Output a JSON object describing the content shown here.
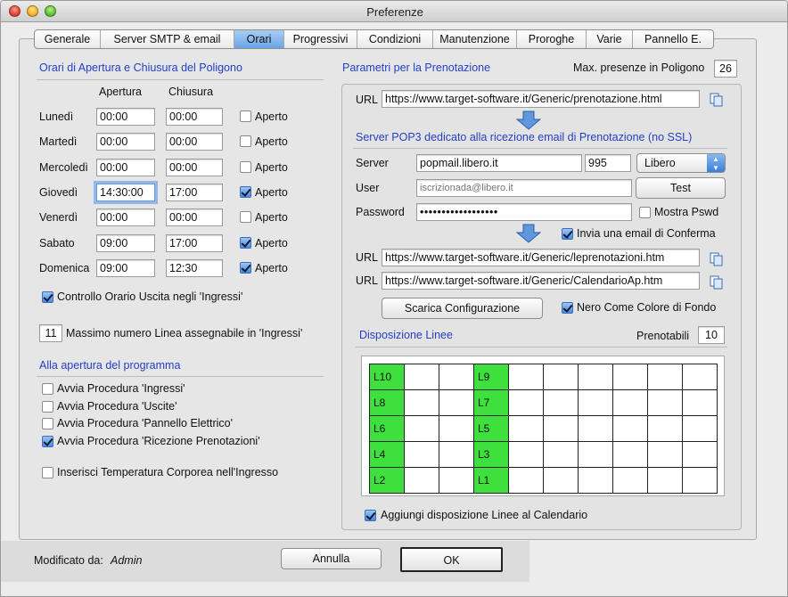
{
  "window": {
    "title": "Preferenze"
  },
  "tabs": [
    {
      "label": "Generale",
      "w": 74
    },
    {
      "label": "Server SMTP & email",
      "w": 150
    },
    {
      "label": "Orari",
      "w": 56,
      "active": true
    },
    {
      "label": "Progressivi",
      "w": 82
    },
    {
      "label": "Condizioni",
      "w": 85
    },
    {
      "label": "Manutenzione",
      "w": 94
    },
    {
      "label": "Proroghe",
      "w": 78
    },
    {
      "label": "Varie",
      "w": 52
    },
    {
      "label": "Pannello E.",
      "w": 90
    }
  ],
  "orari": {
    "title": "Orari di Apertura e Chiusura del Poligono",
    "col_apertura": "Apertura",
    "col_chiusura": "Chiusura",
    "aperto_label": "Aperto",
    "days": [
      {
        "name": "Lunedì",
        "open": "00:00",
        "close": "00:00",
        "aperto": false
      },
      {
        "name": "Martedì",
        "open": "00:00",
        "close": "00:00",
        "aperto": false
      },
      {
        "name": "Mercoledì",
        "open": "00:00",
        "close": "00:00",
        "aperto": false
      },
      {
        "name": "Giovedì",
        "open": "14:30:00",
        "close": "17:00",
        "aperto": true
      },
      {
        "name": "Venerdì",
        "open": "00:00",
        "close": "00:00",
        "aperto": false
      },
      {
        "name": "Sabato",
        "open": "09:00",
        "close": "17:00",
        "aperto": true
      },
      {
        "name": "Domenica",
        "open": "09:00",
        "close": "12:30",
        "aperto": true
      }
    ],
    "controllo_label": "Controllo Orario Uscita negli 'Ingressi'",
    "controllo_checked": true,
    "max_linea_value": "11",
    "max_linea_label": "Massimo numero Linea assegnabile in 'Ingressi'"
  },
  "apertura": {
    "title": "Alla apertura del programma",
    "items": [
      {
        "label": "Avvia Procedura 'Ingressi'",
        "checked": false
      },
      {
        "label": "Avvia Procedura 'Uscite'",
        "checked": false
      },
      {
        "label": "Avvia Procedura 'Pannello Elettrico'",
        "checked": false
      },
      {
        "label": "Avvia Procedura 'Ricezione Prenotazioni'",
        "checked": true
      }
    ],
    "temperatura_label": "Inserisci Temperatura Corporea nell'Ingresso",
    "temperatura_checked": false
  },
  "prenotazione": {
    "title": "Parametri per la Prenotazione",
    "max_presenze_label": "Max. presenze in Poligono",
    "max_presenze_value": "26",
    "url_label": "URL",
    "url1": "https://www.target-software.it/Generic/prenotazione.html",
    "pop3_title": "Server POP3 dedicato alla ricezione email di Prenotazione (no SSL)",
    "server_label": "Server",
    "server_value": "popmail.libero.it",
    "port_value": "995",
    "provider": "Libero",
    "user_label": "User",
    "user_value": "iscrizionada@libero.it",
    "test_label": "Test",
    "password_label": "Password",
    "password_value": "••••••••••••••••••",
    "mostra_label": "Mostra Pswd",
    "mostra_checked": false,
    "invia_label": "Invia una email di Conferma",
    "invia_checked": true,
    "url2": "https://www.target-software.it/Generic/leprenotazioni.htm",
    "url3": "https://www.target-software.it/Generic/CalendarioAp.htm",
    "scarica_label": "Scarica Configurazione",
    "nero_label": "Nero Come Colore di Fondo",
    "nero_checked": true
  },
  "linee": {
    "title": "Disposizione Linee",
    "prenotabili_label": "Prenotabili",
    "prenotabili_value": "10",
    "rows": [
      [
        "L10",
        "",
        "",
        "L9",
        "",
        "",
        "",
        "",
        "",
        ""
      ],
      [
        "L8",
        "",
        "",
        "L7",
        "",
        "",
        "",
        "",
        "",
        ""
      ],
      [
        "L6",
        "",
        "",
        "L5",
        "",
        "",
        "",
        "",
        "",
        ""
      ],
      [
        "L4",
        "",
        "",
        "L3",
        "",
        "",
        "",
        "",
        "",
        ""
      ],
      [
        "L2",
        "",
        "",
        "L1",
        "",
        "",
        "",
        "",
        "",
        ""
      ]
    ],
    "aggiungi_label": "Aggiungi disposizione Linee al Calendario",
    "aggiungi_checked": true
  },
  "footer": {
    "modificato_label": "Modificato da:",
    "modificato_user": "Admin",
    "annulla_label": "Annulla",
    "ok_label": "OK"
  },
  "colors": {
    "accent_blue": "#2440c8",
    "grid_green": "#3ee03e"
  }
}
